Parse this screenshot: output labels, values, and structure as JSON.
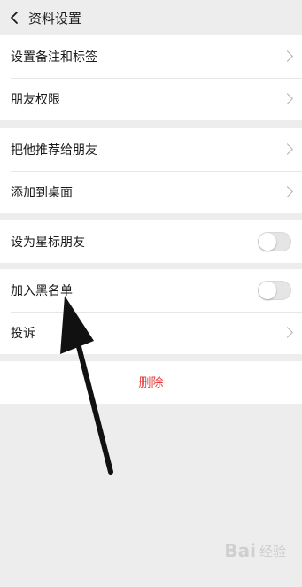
{
  "header": {
    "title": "资料设置",
    "back_icon": "chevron-left-icon"
  },
  "group1": {
    "items": [
      {
        "label": "设置备注和标签"
      },
      {
        "label": "朋友权限"
      }
    ]
  },
  "group2": {
    "items": [
      {
        "label": "把他推荐给朋友"
      },
      {
        "label": "添加到桌面"
      }
    ]
  },
  "group3": {
    "star_label": "设为星标朋友",
    "star_enabled": false
  },
  "group4": {
    "blacklist_label": "加入黑名单",
    "blacklist_enabled": false,
    "complain_label": "投诉"
  },
  "delete": {
    "label": "删除",
    "color": "#e64340"
  },
  "watermark": {
    "text": "Bai",
    "suffix": "经验"
  }
}
